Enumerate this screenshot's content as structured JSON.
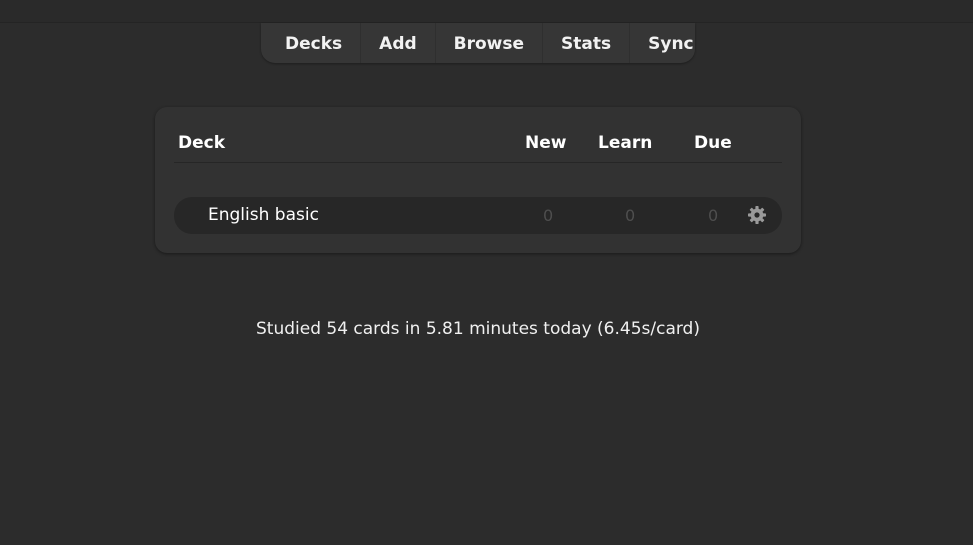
{
  "toolbar": {
    "items": [
      {
        "label": "Decks"
      },
      {
        "label": "Add"
      },
      {
        "label": "Browse"
      },
      {
        "label": "Stats"
      },
      {
        "label": "Sync"
      }
    ]
  },
  "deck_table": {
    "headers": {
      "deck": "Deck",
      "new": "New",
      "learn": "Learn",
      "due": "Due"
    },
    "rows": [
      {
        "name": "English basic",
        "new": "0",
        "learn": "0",
        "due": "0",
        "options_icon": "gear-icon"
      }
    ]
  },
  "footer": {
    "studied_text": "Studied 54 cards in 5.81 minutes today (6.45s/card)"
  },
  "colors": {
    "background": "#2c2c2c",
    "card": "#323232",
    "row": "#272727",
    "muted_count": "#4e4e4e"
  }
}
